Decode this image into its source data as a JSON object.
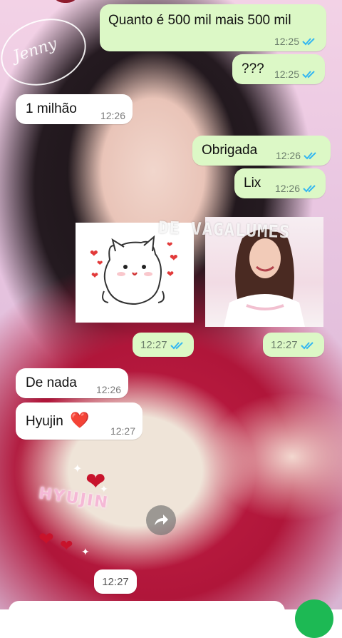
{
  "messages": [
    {
      "text": "Quanto é 500 mil mais 500 mil",
      "time": "12:25"
    },
    {
      "text": "???",
      "time": "12:25"
    },
    {
      "text": "1 milhão",
      "time": "12:26"
    },
    {
      "text": "Obrigada",
      "time": "12:26"
    },
    {
      "text": "Lix",
      "time": "12:26"
    },
    {
      "sticker": "cat-hearts-sticker",
      "time": "12:27"
    },
    {
      "sticker": "photo-sticker",
      "watermark": "DE VAGALUMES",
      "time": "12:27"
    },
    {
      "text": "De nada",
      "time": "12:26"
    },
    {
      "text": "Hyujin",
      "emoji": "❤️",
      "time": "12:27"
    },
    {
      "sticker": "hyujin-hearts-sticker",
      "caption": "HYUJIN",
      "time": "12:27"
    }
  ],
  "wallpaper": {
    "ring_text": "Jenny"
  },
  "colors": {
    "outgoing": "#dcf8c6",
    "incoming": "#ffffff",
    "tick": "#34b7f1",
    "accent": "#1db954"
  },
  "icons": {
    "read_receipt": "double-check-icon",
    "forward": "forward-icon",
    "mic": "mic-icon"
  }
}
